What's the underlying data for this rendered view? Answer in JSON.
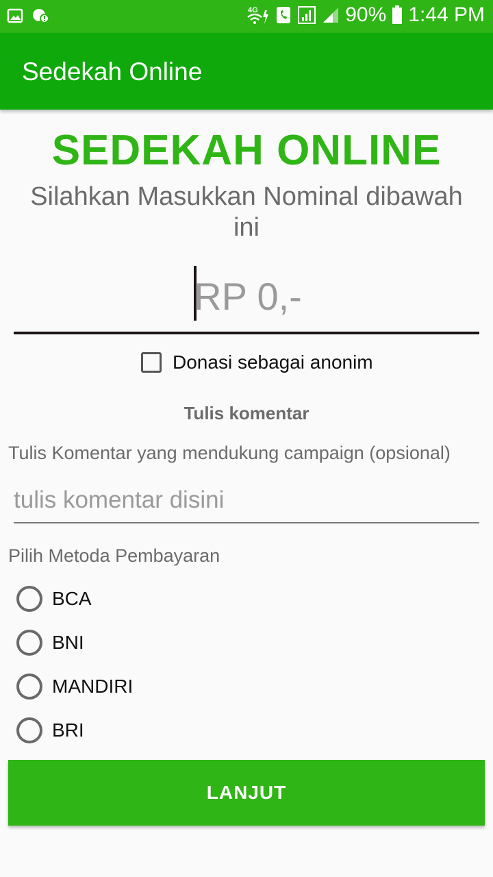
{
  "status_bar": {
    "network": "4G",
    "battery": "90%",
    "time": "1:44 PM"
  },
  "app_bar": {
    "title": "Sedekah Online"
  },
  "form": {
    "heading": "SEDEKAH ONLINE",
    "subheading": "Silahkan Masukkan Nominal dibawah ini",
    "amount_placeholder": "RP 0,-",
    "anonymous_label": "Donasi sebagai anonim",
    "comment_section_title": "Tulis komentar",
    "comment_hint": "Tulis Komentar yang mendukung campaign (opsional)",
    "comment_placeholder": "tulis komentar disini",
    "payment_title": "Pilih Metoda Pembayaran",
    "payment_methods": [
      "BCA",
      "BNI",
      "MANDIRI",
      "BRI"
    ],
    "submit_label": "LANJUT"
  },
  "colors": {
    "status_bar": "#2fb515",
    "app_bar": "#10a90b",
    "accent": "#2fb515"
  }
}
